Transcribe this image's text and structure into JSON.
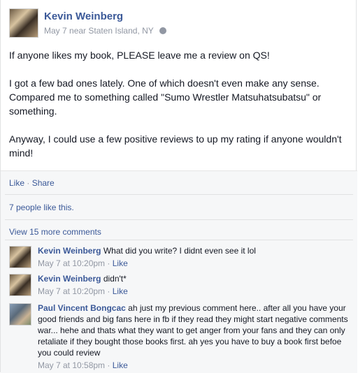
{
  "post": {
    "author": "Kevin Weinberg",
    "date": "May 7",
    "location_prefix": "near",
    "location": "Staten Island, NY",
    "privacy_icon": "globe-icon",
    "paragraphs": [
      "If anyone likes my book, PLEASE leave me a review on QS!",
      "I got a few bad ones lately. One of which doesn't even make any sense. Compared me to something called \"Sumo Wrestler Matsuhatsubatsu\" or something.",
      "Anyway, I could use a few positive reviews to up my rating if anyone wouldn't mind!"
    ]
  },
  "actions": {
    "like": "Like",
    "separator": "·",
    "share": "Share"
  },
  "likes_summary": "7 people like this.",
  "more_comments": "View 15 more comments",
  "comments": [
    {
      "author": "Kevin Weinberg",
      "text": "What did you write? I didnt even see it lol",
      "time": "May 7 at 10:20pm",
      "like": "Like"
    },
    {
      "author": "Kevin Weinberg",
      "text": "didn't*",
      "time": "May 7 at 10:20pm",
      "like": "Like"
    },
    {
      "author": "Paul Vincent Bongcac",
      "text": "ah just my previous comment here.. after all you have your good friends and big fans here in fb if they read they might start negative comments war... hehe and thats what they want to get anger from your fans and they can only retaliate if they bought those books first. ah yes you have to buy a book first befoe you could review",
      "time": "May 7 at 10:58pm",
      "like": "Like"
    }
  ],
  "colors": {
    "link": "#3b5998",
    "meta": "#9197a3",
    "footer_bg": "#f6f7f8"
  }
}
